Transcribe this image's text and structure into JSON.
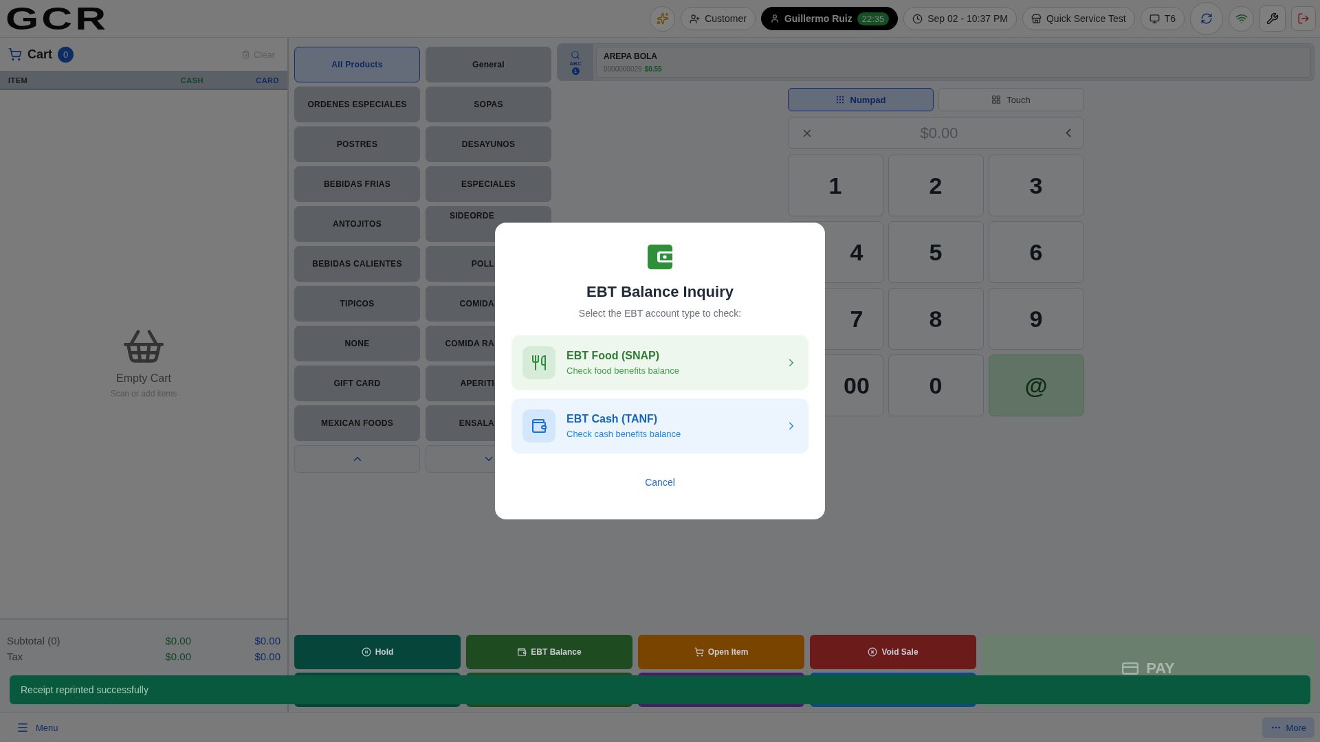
{
  "logo": "GCR",
  "header": [
    {
      "kind": "ai"
    },
    {
      "kind": "customer",
      "label": "Customer"
    },
    {
      "kind": "user",
      "label": "Guillermo Ruiz",
      "badge": "22:35"
    },
    {
      "kind": "datetime",
      "label": "Sep 02 - 10:37 PM"
    },
    {
      "kind": "store",
      "label": "Quick Service Test"
    },
    {
      "kind": "terminal",
      "label": "T6"
    },
    {
      "kind": "sync"
    },
    {
      "kind": "wifi"
    },
    {
      "kind": "tools"
    },
    {
      "kind": "logout"
    }
  ],
  "cart": {
    "title": "Cart",
    "count": "0",
    "clear": "Clear",
    "columns": [
      {
        "label": "ITEM",
        "kind": "item"
      },
      {
        "label": "CASH",
        "kind": "cash"
      },
      {
        "label": "CARD",
        "kind": "card"
      }
    ],
    "empty_title": "Empty Cart",
    "empty_hint": "Scan or add items",
    "totals": [
      {
        "label": "Subtotal (0)",
        "cash": "$0.00",
        "card": "$0.00"
      },
      {
        "label": "Tax",
        "cash": "$0.00",
        "card": "$0.00"
      }
    ]
  },
  "categories": [
    {
      "label": "All Products",
      "selected": true
    },
    {
      "label": "General",
      "selected": false
    },
    {
      "label": "ORDENES ESPECIALES",
      "selected": false
    },
    {
      "label": "SOPAS",
      "selected": false
    },
    {
      "label": "POSTRES",
      "selected": false
    },
    {
      "label": "DESAYUNOS",
      "selected": false
    },
    {
      "label": "BEBIDAS FRIAS",
      "selected": false
    },
    {
      "label": "ESPECIALES",
      "selected": false
    },
    {
      "label": "ANTOJITOS",
      "selected": false
    },
    {
      "label": "SIDEORDE",
      "selected": false
    },
    {
      "label": "BEBIDAS CALIENTES",
      "selected": false
    },
    {
      "label": "POLL",
      "selected": false
    },
    {
      "label": "TIPICOS",
      "selected": false
    },
    {
      "label": "COMIDA",
      "selected": false
    },
    {
      "label": "NONE",
      "selected": false
    },
    {
      "label": "COMIDA RA",
      "selected": false
    },
    {
      "label": "GIFT CARD",
      "selected": false
    },
    {
      "label": "APERITI",
      "selected": false
    },
    {
      "label": "MEXICAN FOODS",
      "selected": false
    },
    {
      "label": "ENSALA",
      "selected": false
    }
  ],
  "search": {
    "mode": "ABC",
    "badge": "1"
  },
  "item": {
    "name": "AREPA BOLA",
    "code": "0000000029",
    "price": "$0.55"
  },
  "numpad": {
    "modes": [
      {
        "label": "Numpad",
        "kind": "numpad",
        "selected": true
      },
      {
        "label": "Touch",
        "kind": "touch",
        "selected": false
      }
    ],
    "display": "$0.00",
    "keys": [
      {
        "label": "1",
        "kind": "digit"
      },
      {
        "label": "2",
        "kind": "digit"
      },
      {
        "label": "3",
        "kind": "digit"
      },
      {
        "label": "4",
        "kind": "digit"
      },
      {
        "label": "5",
        "kind": "digit"
      },
      {
        "label": "6",
        "kind": "digit"
      },
      {
        "label": "7",
        "kind": "digit"
      },
      {
        "label": "8",
        "kind": "digit"
      },
      {
        "label": "9",
        "kind": "digit"
      },
      {
        "label": "00",
        "kind": "digit"
      },
      {
        "label": "0",
        "kind": "digit"
      },
      {
        "label": "@",
        "kind": "action"
      }
    ]
  },
  "actions": [
    {
      "label": "Hold",
      "kind": "hold",
      "color": "#05453a"
    },
    {
      "label": "EBT Balance",
      "kind": "ebt",
      "color": "#1e4b20"
    },
    {
      "label": "Open Item",
      "kind": "open",
      "color": "#794300"
    },
    {
      "label": "Void Sale",
      "kind": "void",
      "color": "#6c1b1b"
    }
  ],
  "actions_second_row": [
    {
      "color": "#05453a"
    },
    {
      "color": "#1e4b20"
    },
    {
      "color": "#4a1a6b"
    },
    {
      "color": "#0d4a80"
    }
  ],
  "pay": {
    "label": "PAY"
  },
  "toast": "Receipt reprinted successfully",
  "bottom": {
    "menu": "Menu",
    "more": "More"
  },
  "modal": {
    "title": "EBT Balance Inquiry",
    "subtitle": "Select the EBT account type to check:",
    "options": [
      {
        "kind": "food",
        "title": "EBT Food (SNAP)",
        "hint": "Check food benefits balance"
      },
      {
        "kind": "cash",
        "title": "EBT Cash (TANF)",
        "hint": "Check cash benefits balance"
      }
    ],
    "cancel": "Cancel"
  }
}
